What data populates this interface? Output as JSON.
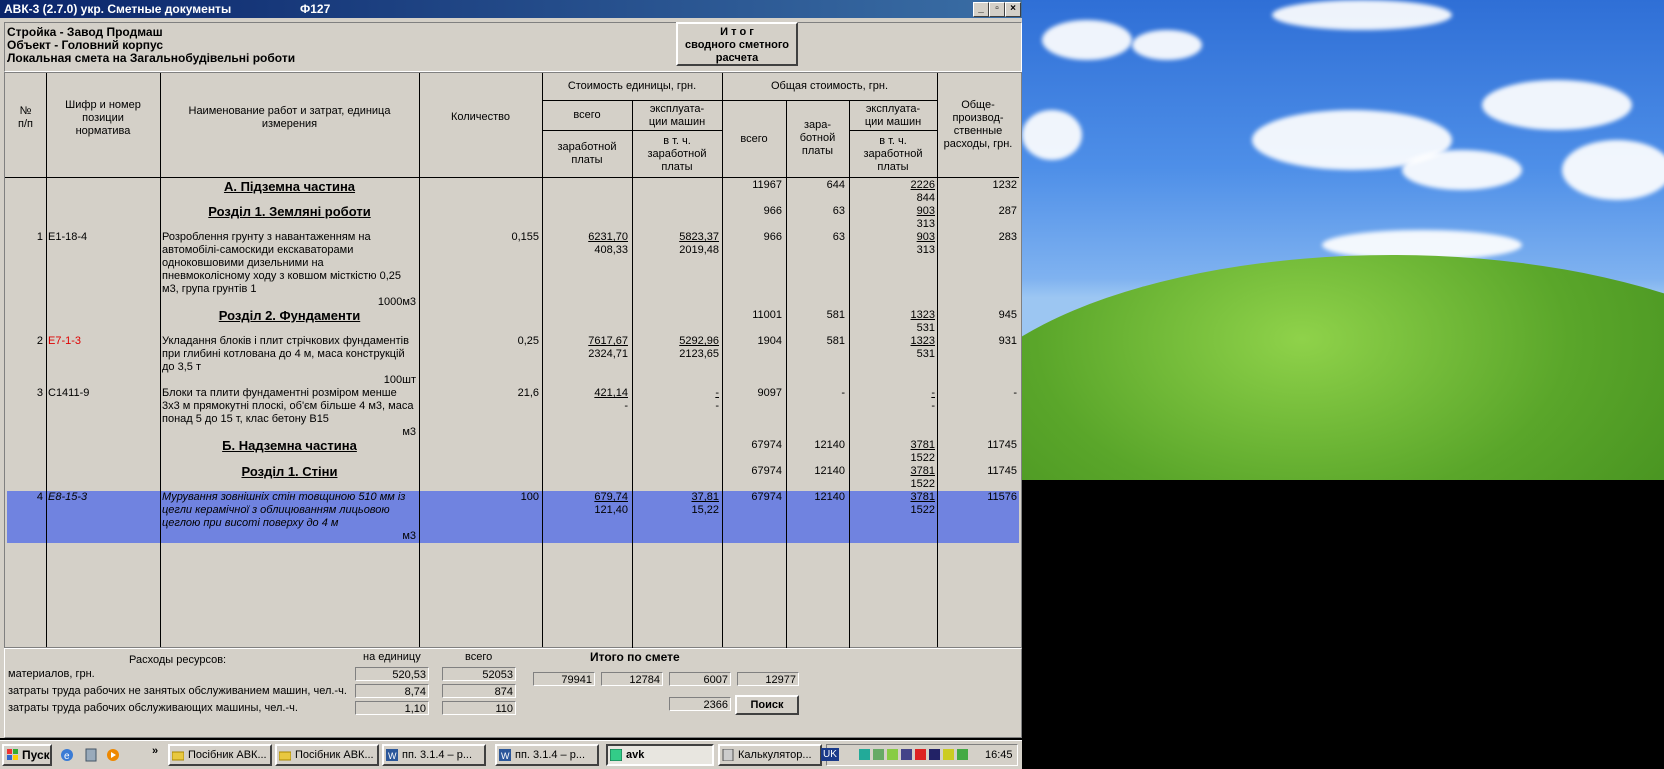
{
  "window": {
    "title": "АВК-3 (2.7.0)  укр.  Сметные документы",
    "code": "Ф127",
    "btn_min": "_",
    "btn_max": "▫",
    "btn_close": "×"
  },
  "header": {
    "line1": "Стройка - Завод Продмаш",
    "line2": "Объект - Головний корпус",
    "line3": "Локальная смета на Загальнобудівельні роботи",
    "itog_line1": "И т о г",
    "itog_line2": "сводного сметного",
    "itog_line3": "расчета"
  },
  "columns": {
    "num": "№\nп/п",
    "code": "Шифр и номер\nпозиции\nнорматива",
    "name": "Наименование работ и затрат, единица\nизмерения",
    "qty": "Количество",
    "unit_cost": "Стоимость единицы, грн.",
    "unit_total": "всего",
    "unit_mach": "эксплуата-\nции машин",
    "unit_wage": "заработной\nплаты",
    "unit_mach_wage": "в т. ч.\nзаработной\nплаты",
    "total_cost": "Общая стоимость, грн.",
    "total_total": "всего",
    "total_wage": "зара-\nботной\nплаты",
    "total_mach": "эксплуата-\nции машин",
    "total_mach_wage": "в т. ч.\nзаработной\nплаты",
    "overhead": "Обще-\nпроизвод-\nственные\nрасходы, грн."
  },
  "rows": {
    "partA": {
      "title": "А.   Підземна частина",
      "total": "11967",
      "wage": "644",
      "mach": "2226",
      "mach_wage": "844",
      "overhead": "1232"
    },
    "sec1": {
      "title": "Розділ 1. Земляні роботи",
      "total": "966",
      "wage": "63",
      "mach": "903",
      "mach_wage": "313",
      "overhead": "287"
    },
    "item1": {
      "num": "1",
      "code": "Е1-18-4",
      "name1": "Розроблення грунту з навантаженням на",
      "name2": "автомобілі-самоскиди екскаваторами",
      "name3": "одноковшовими дизельними на",
      "name4": "пневмоколісному ходу з ковшом місткістю 0,25",
      "name5": "м3, група грунтів 1",
      "unit": "1000м3",
      "qty": "0,155",
      "u_total": "6231,70",
      "u_wage": "408,33",
      "u_mach": "5823,37",
      "u_mach_wage": "2019,48",
      "total": "966",
      "wage": "63",
      "mach": "903",
      "mach_wage": "313",
      "overhead": "283"
    },
    "sec2": {
      "title": "Розділ 2. Фундаменти",
      "total": "11001",
      "wage": "581",
      "mach": "1323",
      "mach_wage": "531",
      "overhead": "945"
    },
    "item2": {
      "num": "2",
      "code": "Е7-1-3",
      "name1": "Укладання блоків і плит стрічкових фундаментів",
      "name2": "при глибині котлована до 4 м, маса конструкцій",
      "name3": "до 3,5 т",
      "unit": "100шт",
      "qty": "0,25",
      "u_total": "7617,67",
      "u_wage": "2324,71",
      "u_mach": "5292,96",
      "u_mach_wage": "2123,65",
      "total": "1904",
      "wage": "581",
      "mach": "1323",
      "mach_wage": "531",
      "overhead": "931"
    },
    "item3": {
      "num": "3",
      "code": "С1411-9",
      "name1": "Блоки та плити фундаментні розміром менше",
      "name2": "3х3 м прямокутні плоскі, об'єм більше 4 м3, маса",
      "name3": "понад 5 до 15 т, клас бетону В15",
      "unit": "м3",
      "qty": "21,6",
      "u_total": "421,14",
      "u_wage": "-",
      "u_mach": "-",
      "u_mach_wage": "-",
      "total": "9097",
      "wage": "-",
      "mach": "-",
      "mach_wage": "-",
      "overhead": "-"
    },
    "partB": {
      "title": "Б.   Надземна частина",
      "total": "67974",
      "wage": "12140",
      "mach": "3781",
      "mach_wage": "1522",
      "overhead": "11745"
    },
    "secB1": {
      "title": "Розділ 1. Стіни",
      "total": "67974",
      "wage": "12140",
      "mach": "3781",
      "mach_wage": "1522",
      "overhead": "11745"
    },
    "item4": {
      "num": "4",
      "code": "Е8-15-3",
      "name1": "Мурування зовнішніх стін товщиною 510 мм із",
      "name2": "цегли керамічної з облицюванням лицьовою",
      "name3": "цеглою при висоті поверху до 4 м",
      "unit": "м3",
      "qty": "100",
      "u_total": "679,74",
      "u_wage": "121,40",
      "u_mach": "37,81",
      "u_mach_wage": "15,22",
      "total": "67974",
      "wage": "12140",
      "mach": "3781",
      "mach_wage": "1522",
      "overhead": "11576"
    }
  },
  "bottom": {
    "res_title": "Расходы ресурсов:",
    "per_unit": "на единицу",
    "total": "всего",
    "itog_title": "Итого    по    смете",
    "mat_label": "материалов, грн.",
    "mat_unit": "520,53",
    "mat_total": "52053",
    "lab1_label": "затраты труда рабочих не занятых обслуживанием машин, чел.-ч.",
    "lab1_unit": "8,74",
    "lab1_total": "874",
    "lab2_label": "затраты труда рабочих обслуживающих машины, чел.-ч.",
    "lab2_unit": "1,10",
    "lab2_total": "110",
    "itog1": "79941",
    "itog2": "12784",
    "itog3": "6007",
    "itog4": "12977",
    "itog5": "2366",
    "search": "Поиск"
  },
  "taskbar": {
    "start": "Пуск",
    "more": "»",
    "t1": "Посібник АВК...",
    "t2": "Посібник АВК...",
    "t3": "пп. 3.1.4 – р...",
    "t4": "пп. 3.1.4 – р...",
    "t5": "avk",
    "t6": "Калькулятор...",
    "lang": "UK",
    "clock": "16:45"
  }
}
